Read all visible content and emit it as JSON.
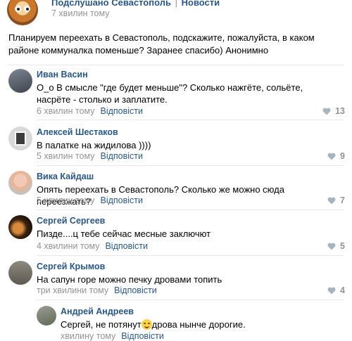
{
  "post": {
    "group_name": "Подслушано Севастополь",
    "separator": "|",
    "section": "Новости",
    "time": "7 хвилин тому",
    "text": "Планируем переехать в Севастополь, подскажите, пожалуйста, в каком районе коммуналка поменьше? Заранее спасибо) Анонимно"
  },
  "reply_label": "Відповісти",
  "comments": [
    {
      "author": "Иван Васин",
      "text": "О_о В смысле \"где будет меньше\"? Сколько нажгёте, сольёте, насрёте - столько и заплатите.",
      "time": "6 хвилин тому",
      "likes": "13"
    },
    {
      "author": "Алексей Шестаков",
      "text": "В палатке на жидилова ))))",
      "time": "5 хвилин тому",
      "likes": "9"
    },
    {
      "author": "Вика Кайдаш",
      "text": "Опять переехать в Севастополь? Сколько же можно сюда переезжать?",
      "time": "5 хвилин тому",
      "likes": "7"
    },
    {
      "author": "Сергей Сергеев",
      "text": "Пизде....ц тебе сейчас месные заключют",
      "time": "4 хвилини тому",
      "likes": "5"
    },
    {
      "author": "Сергей Крымов",
      "text": "На сапун горе можно печку дровами топить",
      "time": "три хвилини тому",
      "likes": "4"
    }
  ],
  "reply": {
    "author": "Андрей Андреев",
    "text_before": "Сергей, не потянут",
    "text_after": "дрова нынче дорогие.",
    "time": "хвилину тому"
  },
  "colors": {
    "link": "#2a5885",
    "muted": "#939393",
    "divider": "#e7e8ec"
  }
}
